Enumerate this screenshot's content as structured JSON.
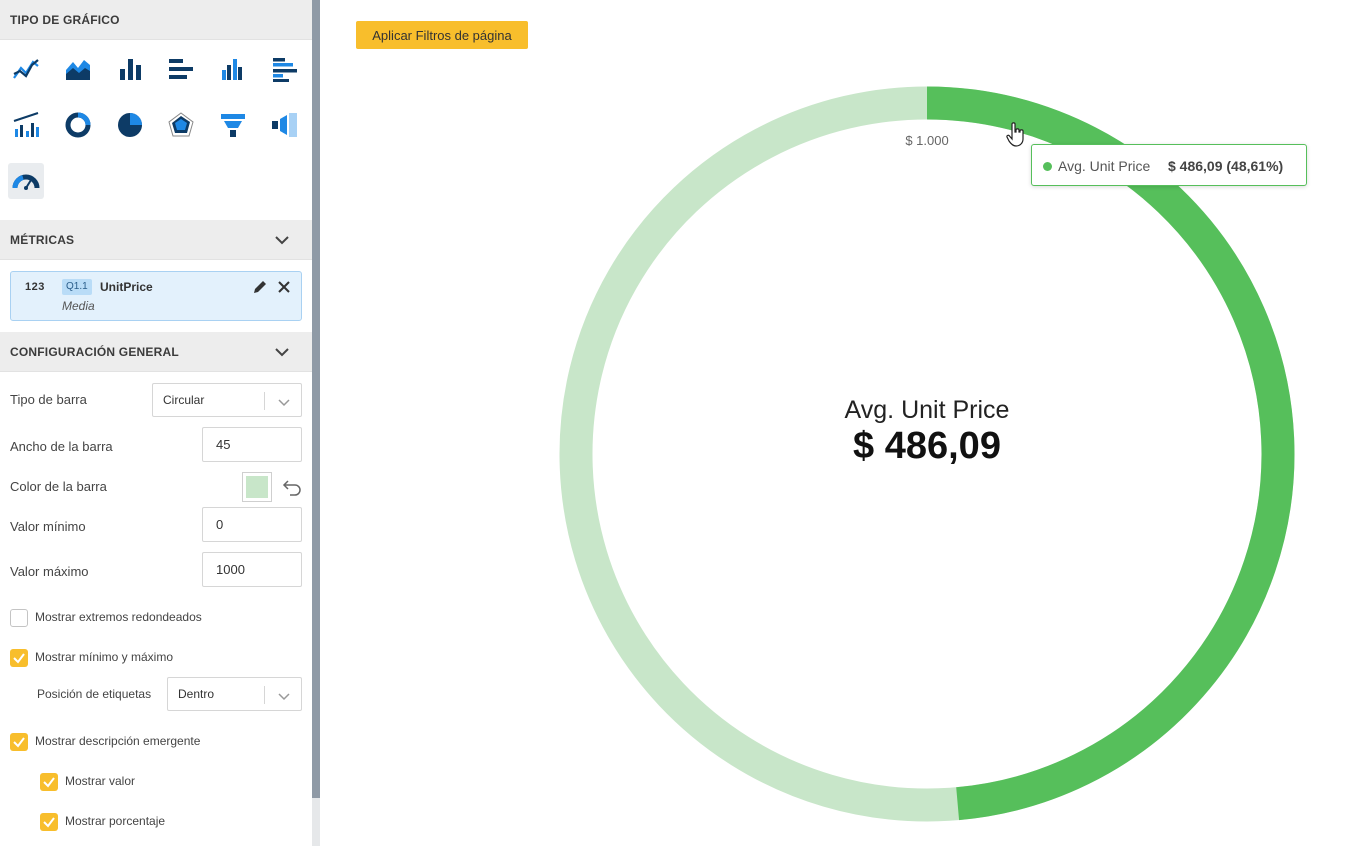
{
  "sidebar": {
    "chart_type_header": "TIPO DE GRÁFICO",
    "chart_types": [
      {
        "name": "line-chart-icon"
      },
      {
        "name": "area-chart-icon"
      },
      {
        "name": "column-chart-icon"
      },
      {
        "name": "bar-chart-icon"
      },
      {
        "name": "grouped-column-chart-icon"
      },
      {
        "name": "grouped-bar-chart-icon"
      },
      {
        "name": "combo-chart-icon"
      },
      {
        "name": "donut-chart-icon"
      },
      {
        "name": "pie-chart-icon"
      },
      {
        "name": "radar-chart-icon"
      },
      {
        "name": "funnel-chart-icon"
      },
      {
        "name": "horizontal-funnel-icon"
      },
      {
        "name": "gauge-chart-icon",
        "selected": true
      }
    ],
    "metrics_header": "MÉTRICAS",
    "metric": {
      "type_label": "123",
      "badge": "Q1.1",
      "name": "UnitPrice",
      "aggregation": "Media"
    },
    "general_header": "CONFIGURACIÓN GENERAL",
    "bar_type": {
      "label": "Tipo de barra",
      "value": "Circular"
    },
    "bar_width": {
      "label": "Ancho de la barra",
      "value": "45"
    },
    "bar_color": {
      "label": "Color de la barra",
      "color": "#c8e6c9"
    },
    "min_value": {
      "label": "Valor mínimo",
      "value": "0"
    },
    "max_value": {
      "label": "Valor máximo",
      "value": "1000"
    },
    "rounded_ends": {
      "label": "Mostrar extremos redondeados",
      "checked": false
    },
    "show_min_max": {
      "label": "Mostrar mínimo y máximo",
      "checked": true
    },
    "label_position": {
      "label": "Posición de etiquetas",
      "value": "Dentro"
    },
    "show_tooltip": {
      "label": "Mostrar descripción emergente",
      "checked": true
    },
    "show_value": {
      "label": "Mostrar valor",
      "checked": true
    },
    "show_percent": {
      "label": "Mostrar porcentaje",
      "checked": true
    }
  },
  "main": {
    "apply_filters_label": "Aplicar Filtros de página"
  },
  "chart_data": {
    "type": "gauge",
    "series": [
      {
        "name": "Avg. Unit Price",
        "value": 486.09
      }
    ],
    "min": 0,
    "max": 1000,
    "title": "Avg. Unit Price",
    "value_text": "$ 486,09",
    "max_label": "$ 1.000",
    "colors": {
      "fill": "#56bf5b",
      "track": "#c8e6c9"
    },
    "tooltip": {
      "series": "Avg. Unit Price",
      "value": "$ 486,09 (48,61%)"
    }
  }
}
